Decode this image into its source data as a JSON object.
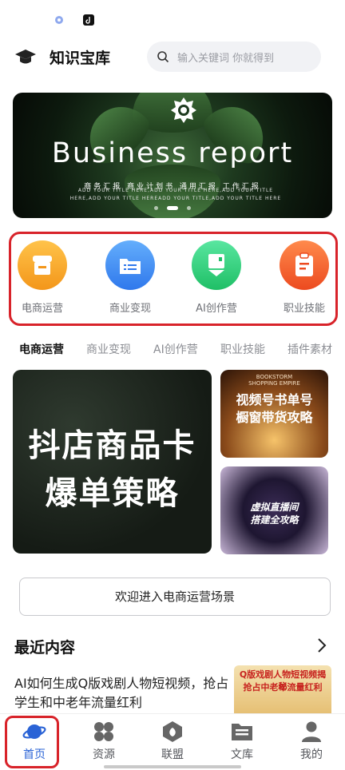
{
  "status_bar": {
    "icons": [
      "app-icon",
      "tiktok-icon"
    ]
  },
  "header": {
    "title": "知识宝库",
    "logo_icon": "graduation-cap-icon",
    "search": {
      "placeholder": "输入关键词 你就得到"
    }
  },
  "banner": {
    "title": "Business report",
    "subtitle": "商务汇报  商业计划书  通用汇报  工作汇报",
    "small_line_1": "ADD YOUR TITLE HERE,ADD YOUR TITLE HERE,ADD YOUR TITLE",
    "small_line_2": "HERE,ADD YOUR TITLE HEREADD YOUR TITLE,ADD YOUR TITLE HERE",
    "slides": 3,
    "active_slide": 2
  },
  "categories": [
    {
      "label": "电商运营",
      "icon": "store-icon",
      "color": "#f7a623"
    },
    {
      "label": "商业变现",
      "icon": "list-folder-icon",
      "color": "#3f8ef3"
    },
    {
      "label": "AI创作营",
      "icon": "bookmark-icon",
      "color": "#2ecf7b"
    },
    {
      "label": "职业技能",
      "icon": "clipboard-icon",
      "color": "#f05a2b"
    }
  ],
  "tabs": [
    "电商运营",
    "商业变现",
    "AI创作营",
    "职业技能",
    "插件素材"
  ],
  "active_tab": "电商运营",
  "cards": {
    "big": {
      "line1": "抖店商品卡",
      "line2": "爆单策略"
    },
    "small1": {
      "brand_line1": "BOOKSTORM",
      "brand_line2": "SHOPPING EMPIRE",
      "line1": "视频号书单号",
      "line2": "橱窗带货攻略"
    },
    "small2": {
      "line1": "虚拟直播间",
      "line2": "搭建全攻略"
    }
  },
  "welcome_button": "欢迎进入电商运营场景",
  "recent": {
    "title": "最近内容",
    "article_title": "AI如何生成Q版戏剧人物短视频，抢占学生和中老年流量红利",
    "thumb_line1": "Q版戏剧人物短视频揭秘",
    "thumb_line2": "抢占中老年流量红利"
  },
  "tabbar": [
    {
      "label": "首页",
      "icon": "planet-icon",
      "active": true
    },
    {
      "label": "资源",
      "icon": "grid-icon",
      "active": false
    },
    {
      "label": "联盟",
      "icon": "leaf-bag-icon",
      "active": false
    },
    {
      "label": "文库",
      "icon": "folder-icon",
      "active": false
    },
    {
      "label": "我的",
      "icon": "person-icon",
      "active": false
    }
  ],
  "colors": {
    "accent": "#2a63d6",
    "highlight": "#d8232a"
  }
}
